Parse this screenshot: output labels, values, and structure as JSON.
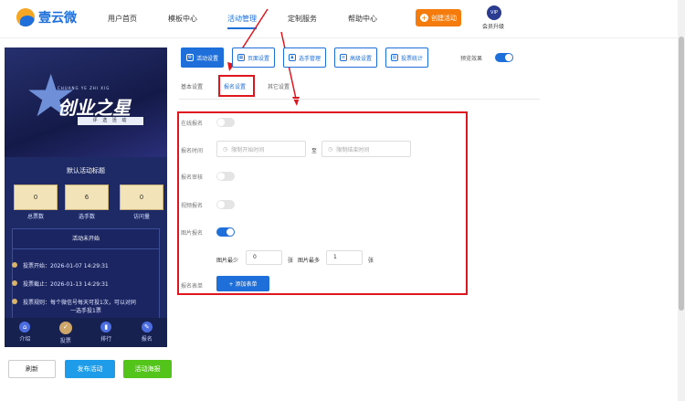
{
  "nav": {
    "logo": "壹云微",
    "items": [
      "用户首页",
      "模板中心",
      "活动管理",
      "定制服务",
      "帮助中心"
    ],
    "create": "创建活动",
    "vip_badge": "VIP",
    "vip_label": "会员升级"
  },
  "phone": {
    "banner_sub": "CHUANG YE ZHI XIG",
    "banner_title": "创业之星",
    "banner_tag": "评 选 活 动",
    "title": "默认活动标题",
    "stats": [
      {
        "value": "0",
        "label": "总票数"
      },
      {
        "value": "6",
        "label": "选手数"
      },
      {
        "value": "0",
        "label": "访问量"
      }
    ],
    "status": "活动未开始",
    "start": "投票开始：2026-01-07 14:29:31",
    "end": "投票截止：2026-01-13 14:29:31",
    "rule1": "投票规则：每个微信号每天可投1次，可以对同",
    "rule2": "一选手投1票",
    "tabs": [
      "介绍",
      "投票",
      "排行",
      "报名"
    ]
  },
  "bottom": {
    "refresh": "刷新",
    "publish": "发布活动",
    "poster": "活动海报"
  },
  "settings": {
    "tabs": [
      "活动设置",
      "页面设置",
      "选手管理",
      "高级设置",
      "投票统计"
    ],
    "preview": "预览效果",
    "subtabs": [
      "基本设置",
      "报名设置",
      "其它设置"
    ]
  },
  "form": {
    "online": "在线报名",
    "time": "报名时间",
    "start_ph": "限制开始时间",
    "to": "至",
    "end_ph": "限制结束时间",
    "audit": "报名审核",
    "video": "视频报名",
    "image": "图片报名",
    "min_label": "图片最少",
    "min_val": "0",
    "unit1": "张",
    "max_label": "图片最多",
    "max_val": "1",
    "unit2": "张",
    "form_label": "报名表单",
    "add_form": "+ 添加表单"
  },
  "colors": {
    "accent": "#1e6fd9",
    "orange": "#f57c0c",
    "red": "#e0161f",
    "green": "#52c41a"
  }
}
